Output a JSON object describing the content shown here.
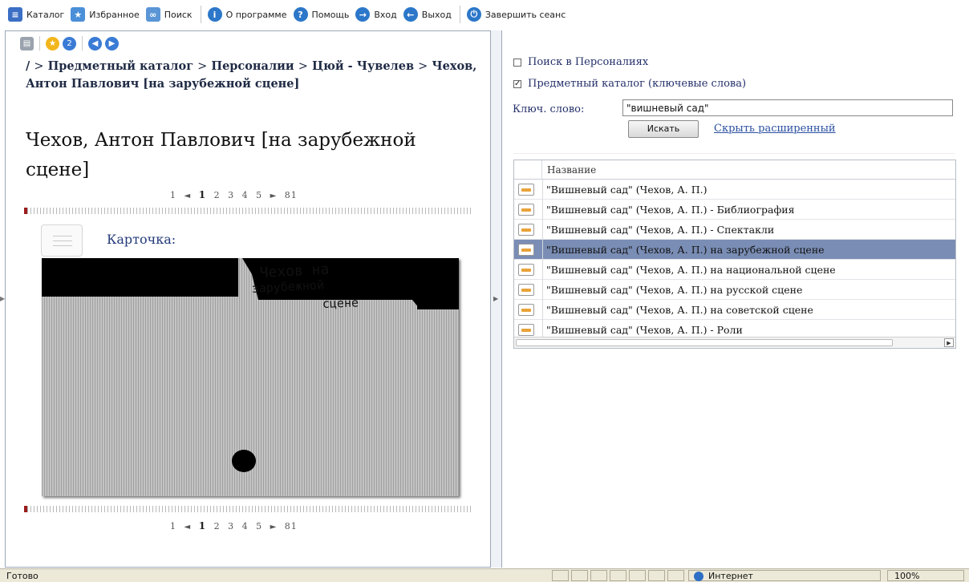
{
  "toolbar": {
    "items": [
      {
        "label": "Каталог",
        "icon": "catalog-icon",
        "color": "#3b6fc5"
      },
      {
        "label": "Избранное",
        "icon": "star-favorites-icon",
        "color": "#4a8fd8"
      },
      {
        "label": "Поиск",
        "icon": "search-icon",
        "color": "#5a95d6"
      },
      {
        "label": "О программе",
        "icon": "info-icon",
        "color": "#2c77c9"
      },
      {
        "label": "Помощь",
        "icon": "help-icon",
        "color": "#2c77c9"
      },
      {
        "label": "Вход",
        "icon": "login-icon",
        "color": "#2c77c9"
      },
      {
        "label": "Выход",
        "icon": "logout-icon",
        "color": "#2c77c9"
      },
      {
        "label": "Завершить сеанс",
        "icon": "power-icon",
        "color": "#2c77c9"
      }
    ]
  },
  "left": {
    "breadcrumb": [
      "/",
      "Предметный каталог",
      "Персоналии",
      "Цюй - Чувелев",
      "Чехов, Антон Павлович [на зарубежной сцене]"
    ],
    "breadcrumb_sep": ">",
    "title": "Чехов, Антон Павлович [на зарубежной сцене]",
    "pager": {
      "first": "1",
      "prev": "◄",
      "pages": [
        "1",
        "2",
        "3",
        "4",
        "5"
      ],
      "current": "1",
      "next": "►",
      "last": "81"
    },
    "card_label": "Карточка:",
    "card_handwriting": [
      "Чехов на",
      "зарубежной",
      "сцене"
    ]
  },
  "right": {
    "options": [
      {
        "label": "Поиск в Персоналиях",
        "checked": false
      },
      {
        "label": "Предметный каталог (ключевые слова)",
        "checked": true
      }
    ],
    "keyword_label": "Ключ. слово:",
    "keyword_value": "\"вишневый сад\"",
    "search_button": "Искать",
    "hide_link": "Скрыть расширенный",
    "grid": {
      "header": "Название",
      "selected_index": 3,
      "rows": [
        "\"Вишневый сад\" (Чехов, А. П.)",
        "\"Вишневый сад\" (Чехов, А. П.) - Библиография",
        "\"Вишневый сад\" (Чехов, А. П.) - Спектакли",
        "\"Вишневый сад\" (Чехов, А. П.) на зарубежной сцене",
        "\"Вишневый сад\" (Чехов, А. П.) на национальной сцене",
        "\"Вишневый сад\" (Чехов, А. П.) на русской сцене",
        "\"Вишневый сад\" (Чехов, А. П.) на советской сцене",
        "\"Вишневый сад\" (Чехов, А. П.) - Роли"
      ]
    }
  },
  "status": {
    "text": "Готово",
    "zone": "Интернет",
    "zoom": "100%"
  },
  "colors": {
    "selected_row": "#7a8db5",
    "link": "#2a4fa0",
    "marker": "#9b1c1c"
  }
}
